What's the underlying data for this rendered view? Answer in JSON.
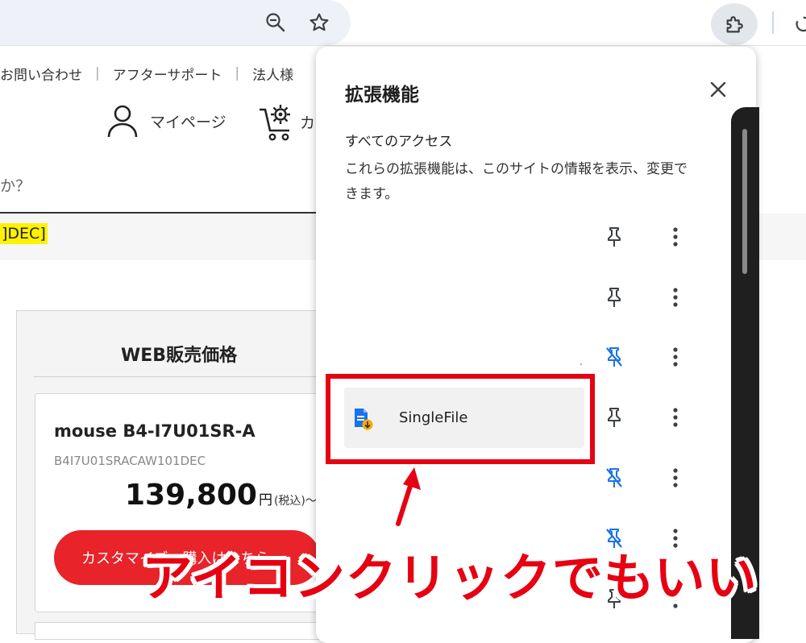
{
  "browser": {
    "zoom_icon": "zoom-out-icon",
    "bookmark_icon": "star-icon",
    "extensions_icon": "puzzle-icon",
    "reload_icon": "reload-icon"
  },
  "page": {
    "topnav": [
      "お問い合わせ",
      "アフターサポート",
      "法人様"
    ],
    "mypage_label": "マイページ",
    "cart_label": "カ",
    "search_hint": "か？",
    "highlight_text": "]DEC]",
    "price_section_title": "WEB販売価格",
    "product": {
      "model": "mouse B4-I7U01SR-A",
      "sku": "B4I7U01SRACAW101DEC",
      "price": "139,800",
      "yen": "円",
      "tax": "(税込)〜",
      "customize_button": "カスタマイズ・購入はこちら"
    }
  },
  "extensions_popup": {
    "title": "拡張機能",
    "access_heading": "すべてのアクセス",
    "access_description": "これらの拡張機能は、このサイトの情報を表示、変更できます。",
    "items": [
      {
        "name": "",
        "pinned": true
      },
      {
        "name": "",
        "pinned": true
      },
      {
        "name": "",
        "pinned": false
      },
      {
        "name": "SingleFile",
        "pinned": true
      },
      {
        "name": "",
        "pinned": false
      },
      {
        "name": "",
        "pinned": false
      },
      {
        "name": "",
        "pinned": true
      }
    ]
  },
  "annotation": {
    "caption": "アイコンクリックでもいい",
    "color": "#e60012"
  },
  "colors": {
    "accent_red": "#e60012",
    "pin_blue": "#1a73e8",
    "buy_button": "#e8232a",
    "highlight_yellow": "#fff200"
  }
}
